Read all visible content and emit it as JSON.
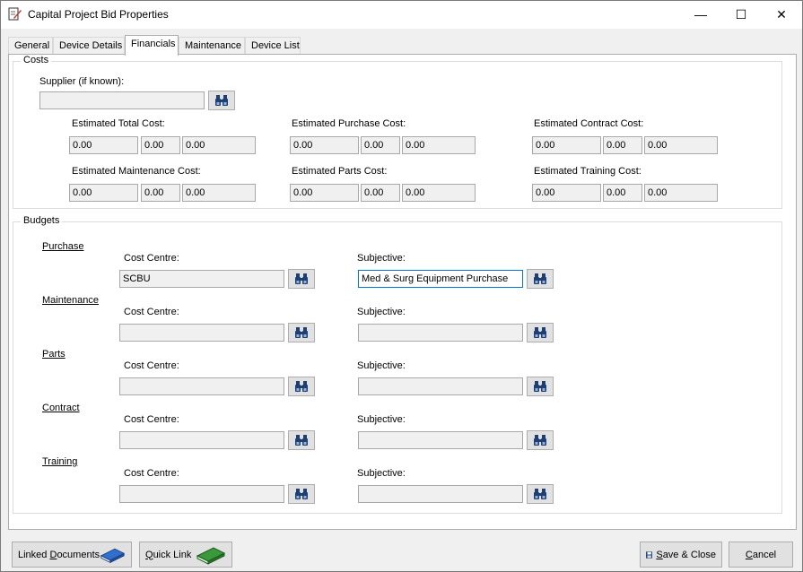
{
  "window": {
    "title": "Capital Project Bid Properties",
    "minimize": "—",
    "maximize": "☐",
    "close": "✕"
  },
  "tabs": [
    {
      "label": "General"
    },
    {
      "label": "Device Details"
    },
    {
      "label": "Financials"
    },
    {
      "label": "Maintenance"
    },
    {
      "label": "Device List"
    }
  ],
  "costs": {
    "legend": "Costs",
    "supplier_label": "Supplier (if known):",
    "supplier_value": "",
    "groups": [
      {
        "label": "Estimated Total Cost:",
        "values": [
          "0.00",
          "0.00",
          "0.00"
        ]
      },
      {
        "label": "Estimated Purchase Cost:",
        "values": [
          "0.00",
          "0.00",
          "0.00"
        ]
      },
      {
        "label": "Estimated Contract Cost:",
        "values": [
          "0.00",
          "0.00",
          "0.00"
        ]
      },
      {
        "label": "Estimated Maintenance Cost:",
        "values": [
          "0.00",
          "0.00",
          "0.00"
        ]
      },
      {
        "label": "Estimated Parts Cost:",
        "values": [
          "0.00",
          "0.00",
          "0.00"
        ]
      },
      {
        "label": "Estimated Training Cost:",
        "values": [
          "0.00",
          "0.00",
          "0.00"
        ]
      }
    ]
  },
  "budgets": {
    "legend": "Budgets",
    "cost_centre_label": "Cost Centre:",
    "subjective_label": "Subjective:",
    "sections": [
      {
        "name": "Purchase",
        "cost_centre": "SCBU",
        "subjective": "Med & Surg Equipment Purchase"
      },
      {
        "name": "Maintenance",
        "cost_centre": "",
        "subjective": ""
      },
      {
        "name": "Parts",
        "cost_centre": "",
        "subjective": ""
      },
      {
        "name": "Contract",
        "cost_centre": "",
        "subjective": ""
      },
      {
        "name": "Training",
        "cost_centre": "",
        "subjective": ""
      }
    ]
  },
  "footer": {
    "linked_documents": {
      "pre": "Linked ",
      "acc": "D",
      "post": "ocuments"
    },
    "quick_link": {
      "pre": "",
      "acc": "Q",
      "post": "uick Link"
    },
    "save_close": {
      "pre": "",
      "acc": "S",
      "post": "ave & Close"
    },
    "cancel": {
      "pre": "",
      "acc": "C",
      "post": "ancel"
    }
  }
}
